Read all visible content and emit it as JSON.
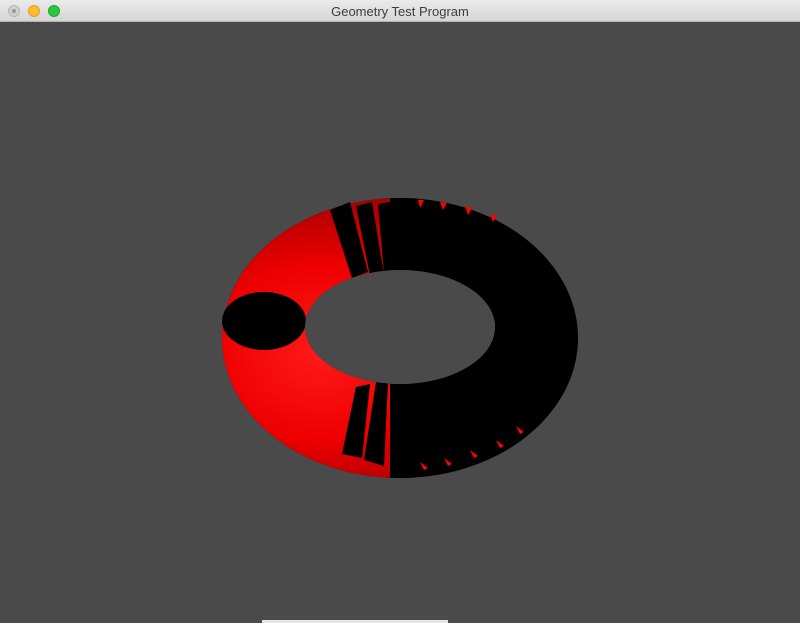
{
  "window": {
    "title": "Geometry Test Program"
  },
  "traffic_lights": {
    "close_icon": "close-icon",
    "minimize_icon": "minimize-icon",
    "zoom_icon": "zoom-icon"
  },
  "scene": {
    "background_color": "#4a4a4a",
    "torus_color": "#ff0000",
    "shadow_color": "#000000"
  }
}
